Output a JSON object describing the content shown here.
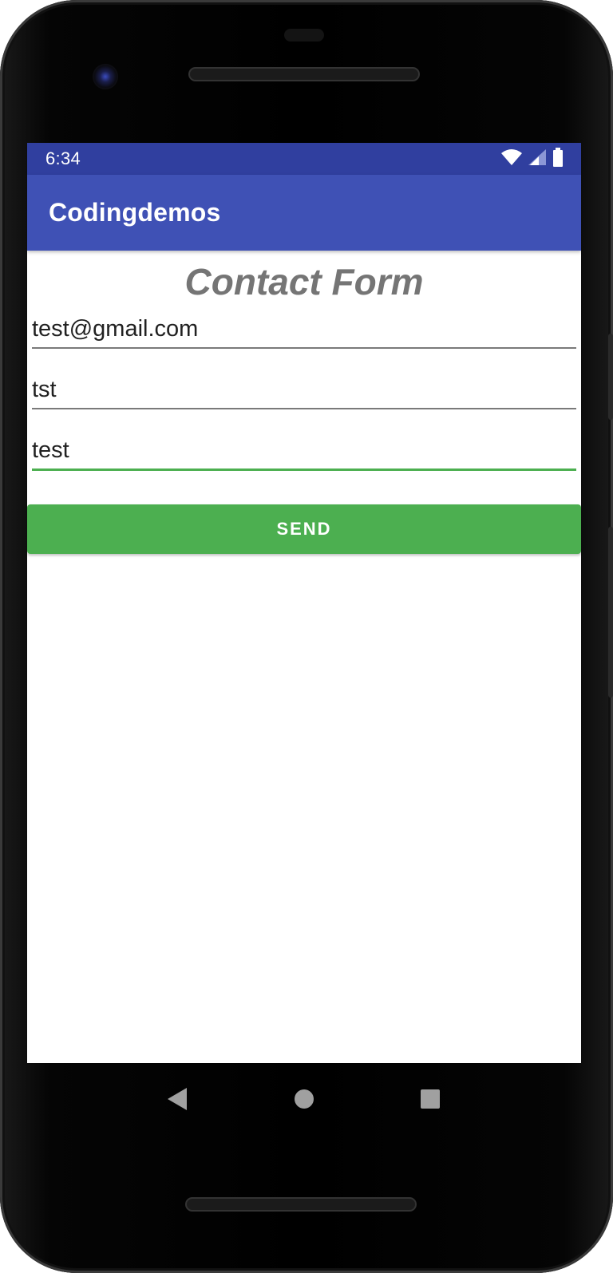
{
  "status_bar": {
    "time": "6:34",
    "icons": [
      "wifi-icon",
      "signal-icon",
      "battery-icon"
    ]
  },
  "app_bar": {
    "title": "Codingdemos",
    "color": "#3f51b5",
    "status_color": "#303f9f"
  },
  "form": {
    "title": "Contact Form",
    "fields": [
      {
        "value": "test@gmail.com"
      },
      {
        "value": "tst"
      },
      {
        "value": "test"
      }
    ],
    "send_label": "SEND",
    "accent_color": "#4caf50"
  },
  "nav_bar": {
    "buttons": [
      "back-icon",
      "home-icon",
      "recents-icon"
    ]
  }
}
